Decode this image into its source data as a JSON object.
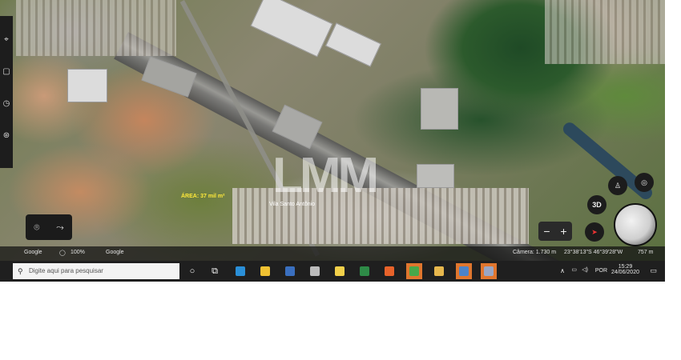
{
  "map": {
    "area_label": "ÁREA: 37 mil m²",
    "place_label": "Vila Santo Antônio",
    "watermark": "LMM"
  },
  "status_bar": {
    "brand": "Google",
    "zoom": "100%",
    "attribution": "Google",
    "camera": "Câmera: 1.730 m",
    "coords": "23°38'13\"S 46°39'28\"W",
    "elevation": "757 m"
  },
  "controls": {
    "btn_3d": "3D"
  },
  "taskbar": {
    "search_placeholder": "Digite aqui para pesquisar",
    "language": "POR",
    "time": "15:29",
    "date": "24/06/2020",
    "apps": [
      {
        "name": "edge",
        "color": "#2a8fd8"
      },
      {
        "name": "explorer",
        "color": "#f1c232"
      },
      {
        "name": "store",
        "color": "#3a6fbf"
      },
      {
        "name": "weather",
        "color": "#bcbcbc"
      },
      {
        "name": "files",
        "color": "#f2d04a"
      },
      {
        "name": "excel",
        "color": "#2e8b47"
      },
      {
        "name": "firefox",
        "color": "#e8622a"
      },
      {
        "name": "chrome",
        "color": "#48a84a"
      },
      {
        "name": "folder",
        "color": "#e7b74d"
      },
      {
        "name": "google-earth",
        "color": "#4b83c9"
      },
      {
        "name": "settings",
        "color": "#9aa6c4"
      }
    ]
  }
}
